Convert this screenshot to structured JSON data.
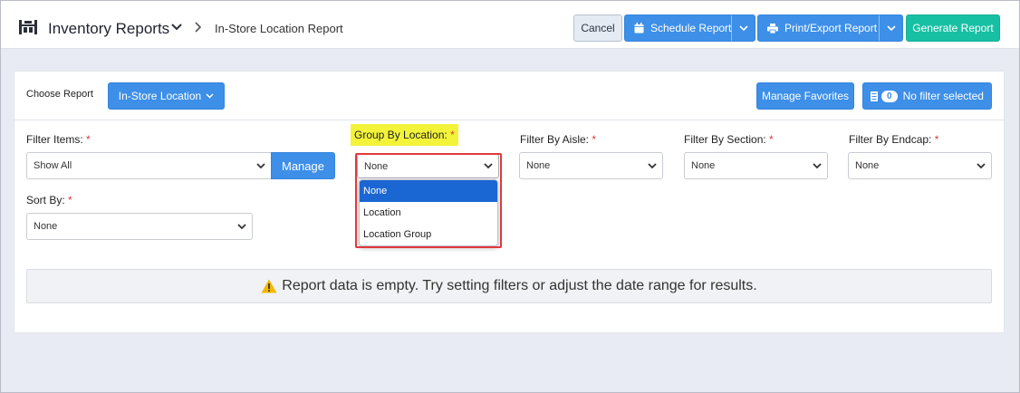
{
  "header": {
    "app_title": "Inventory Reports",
    "breadcrumb": "In-Store Location Report",
    "cancel_label": "Cancel",
    "schedule_label": "Schedule Report",
    "print_label": "Print/Export Report",
    "generate_label": "Generate Report"
  },
  "report_bar": {
    "choose_label": "Choose Report",
    "choose_value": "In-Store Location",
    "favorites_label": "Manage Favorites",
    "filter_count": "0",
    "filter_label": "No filter selected"
  },
  "filters": {
    "items_label": "Filter Items:",
    "items_value": "Show All",
    "manage_label": "Manage",
    "group_label": "Group By Location:",
    "group_value": "None",
    "group_options": [
      "None",
      "Location",
      "Location Group"
    ],
    "aisle_label": "Filter By Aisle:",
    "aisle_value": "None",
    "section_label": "Filter By Section:",
    "section_value": "None",
    "endcap_label": "Filter By Endcap:",
    "endcap_value": "None",
    "sort_label": "Sort By:",
    "sort_value": "None",
    "required_marker": "*"
  },
  "empty_message": "Report data is empty. Try setting filters or adjust the date range for results.",
  "colors": {
    "primary": "#3d8fe8",
    "generate": "#18c0a3",
    "highlight": "#f3f43a",
    "required": "#e53935",
    "callout_border": "#e0393e"
  },
  "icons": [
    "inventory-app-icon",
    "chevron-down-icon",
    "chevron-right-icon",
    "calendar-icon",
    "printer-icon",
    "filter-list-icon",
    "warning-icon"
  ]
}
